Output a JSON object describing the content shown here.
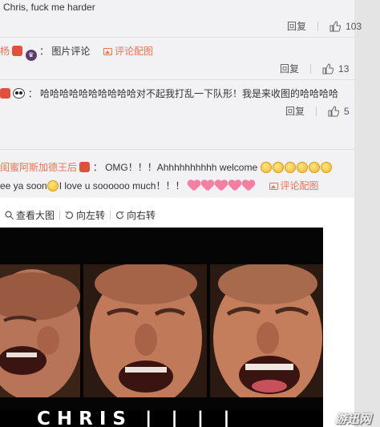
{
  "comments": [
    {
      "text": "Chris, fuck me harder",
      "reply_label": "回复",
      "like_count": "103"
    },
    {
      "username": "杨",
      "separator": "：",
      "text": "图片评论",
      "image_link": "评论配图",
      "reply_label": "回复",
      "like_count": "13"
    },
    {
      "separator": "：",
      "text": "哈哈哈哈哈哈哈哈哈哈对不起我打乱一下队形！我是来收图的哈哈哈哈",
      "reply_label": "回复",
      "like_count": "5"
    },
    {
      "username": "闺蜜阿斯加德王后",
      "separator": "：",
      "text_line1": "OMG！！！Ahhhhhhhhhh welcome",
      "text_line2a": "ee ya soon",
      "text_line2b": "I love u soooooo much！！！",
      "image_link": "评论配图"
    }
  ],
  "toolbar": {
    "view_large": "查看大图",
    "rotate_left": "向左转",
    "rotate_right": "向右转"
  },
  "image": {
    "caption": "CHRIS | | | |",
    "watermark": "游迅网"
  },
  "colors": {
    "link": "#eb7350",
    "background": "#f2f2f5",
    "card": "#ffffff"
  },
  "icons": [
    "thumb-up-icon",
    "image-icon",
    "search-icon",
    "rotate-left-icon",
    "rotate-right-icon"
  ]
}
